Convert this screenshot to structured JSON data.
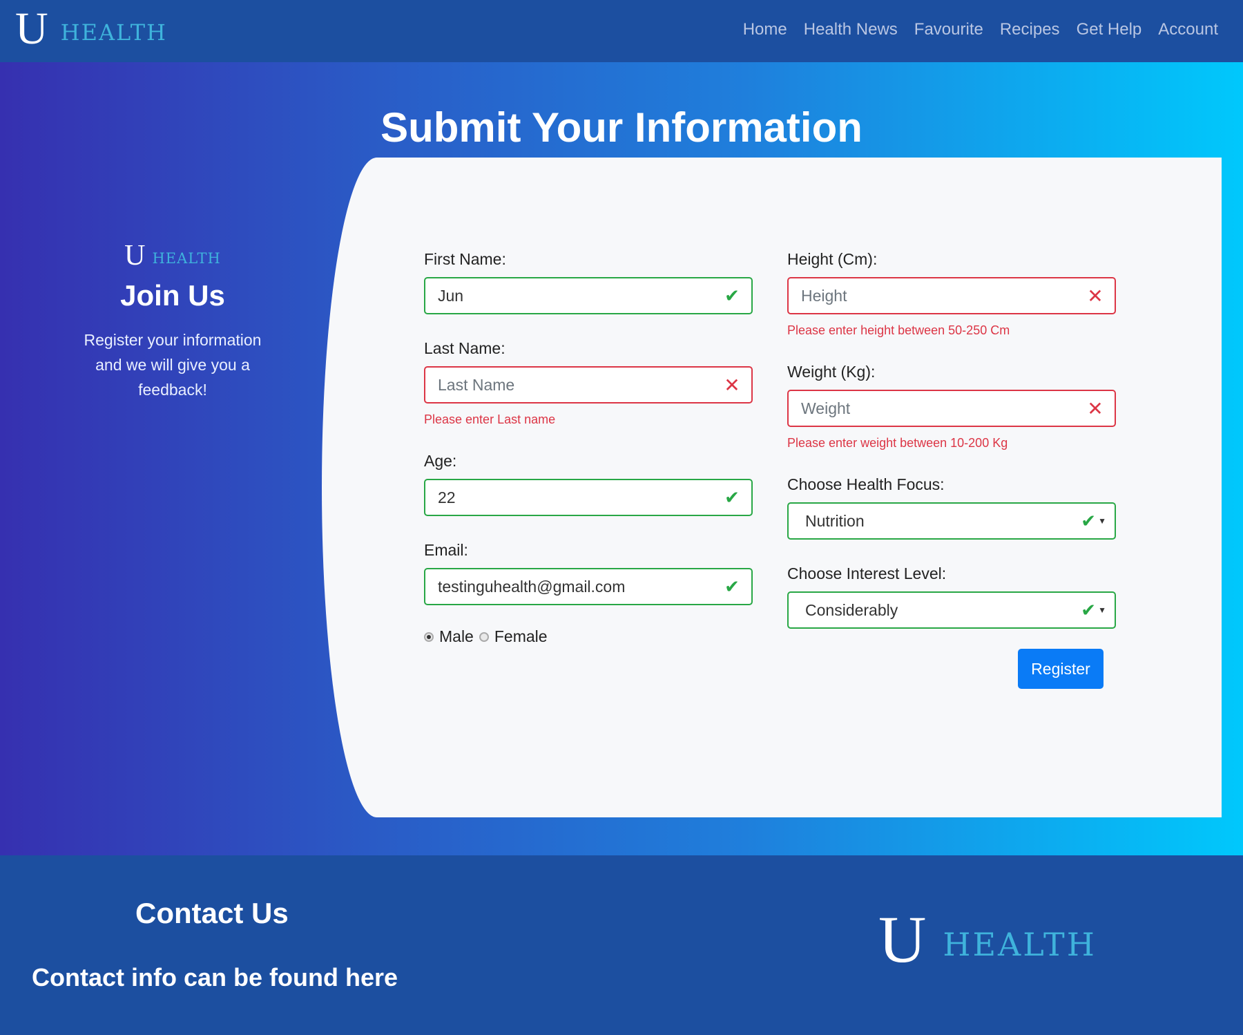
{
  "brand": {
    "u": "U",
    "health": "HEALTH"
  },
  "nav": [
    "Home",
    "Health News",
    "Favourite",
    "Recipes",
    "Get Help",
    "Account"
  ],
  "hero": {
    "title": "Submit Your Information"
  },
  "join": {
    "logo_u": "U",
    "logo_health": "HEALTH",
    "title": "Join Us",
    "text_line1": "Register your information",
    "text_line2": "and we will give you a",
    "text_line3": "feedback!"
  },
  "form": {
    "first_name": {
      "label": "First Name:",
      "value": "Jun",
      "state": "valid"
    },
    "last_name": {
      "label": "Last Name:",
      "placeholder": "Last Name",
      "state": "invalid",
      "error": "Please enter Last name"
    },
    "age": {
      "label": "Age:",
      "value": "22",
      "state": "valid"
    },
    "email": {
      "label": "Email:",
      "value": "testinguhealth@gmail.com",
      "state": "valid"
    },
    "gender": {
      "options": [
        "Male",
        "Female"
      ],
      "selected": "Male"
    },
    "height": {
      "label": "Height (Cm):",
      "placeholder": "Height",
      "state": "invalid",
      "error": "Please enter height between 50-250 Cm"
    },
    "weight": {
      "label": "Weight (Kg):",
      "placeholder": "Weight",
      "state": "invalid",
      "error": "Please enter weight between 10-200 Kg"
    },
    "health_focus": {
      "label": "Choose Health Focus:",
      "value": "Nutrition",
      "state": "valid"
    },
    "interest_level": {
      "label": "Choose Interest Level:",
      "value": "Considerably",
      "state": "valid"
    },
    "register_label": "Register"
  },
  "footer": {
    "contact_title": "Contact Us",
    "contact_info": "Contact info can be found here",
    "logo_u": "U",
    "logo_health": "HEALTH"
  },
  "colors": {
    "navbar": "#1c4fa0",
    "valid": "#28a745",
    "invalid": "#dc3545",
    "button": "#0a7bf6",
    "brand_accent": "#3fb3dc"
  },
  "icons": {
    "valid": "checkmark-icon",
    "invalid": "x-icon",
    "select": "caret-down-icon"
  }
}
